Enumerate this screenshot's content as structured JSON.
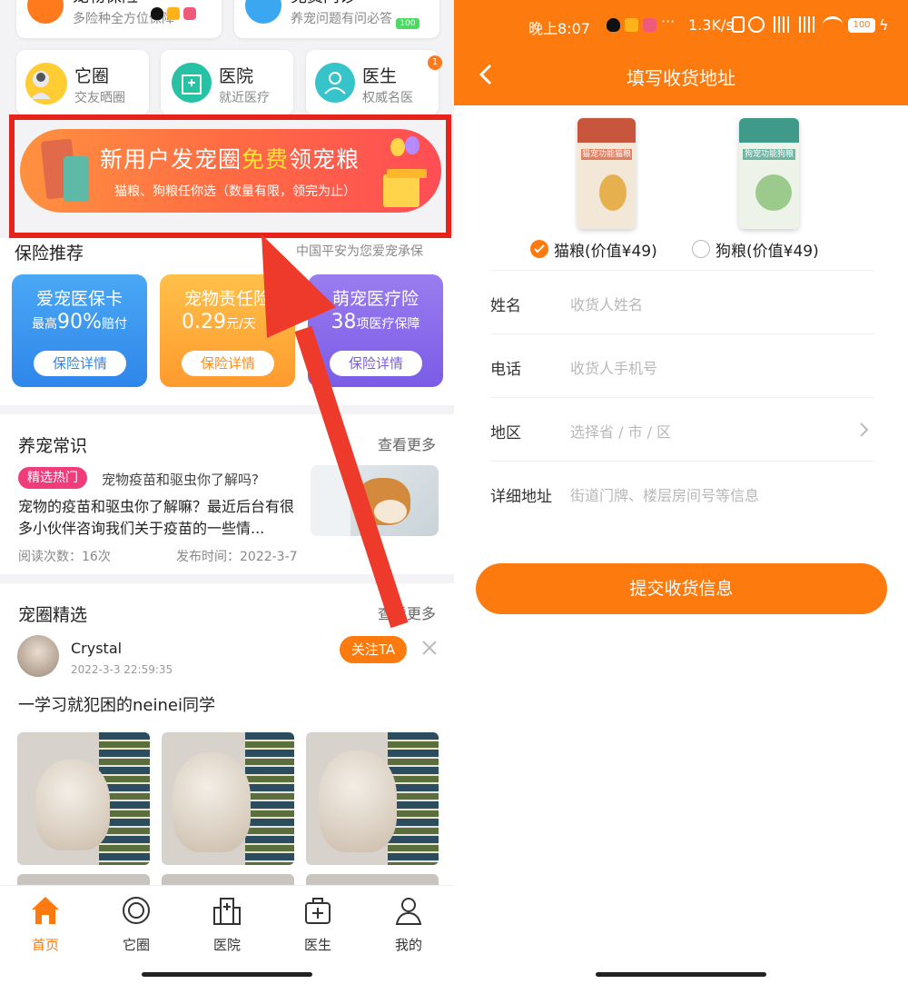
{
  "left": {
    "top_cards": [
      {
        "title": "宠物保险",
        "subtitle": "多险种全方位保障"
      },
      {
        "title": "免费问诊",
        "subtitle": "养宠问题有问必答"
      }
    ],
    "status_overlay": {
      "battery": "100"
    },
    "quick_tiles": [
      {
        "title": "它圈",
        "subtitle": "交友晒圈",
        "icon": "pet-circle-icon"
      },
      {
        "title": "医院",
        "subtitle": "就近医疗",
        "icon": "hospital-icon"
      },
      {
        "title": "医生",
        "subtitle": "权威名医",
        "icon": "doctor-icon",
        "badge": "1"
      }
    ],
    "banner": {
      "title_part1": "新用户发宠圈",
      "title_highlight": "免费",
      "title_part2": "领宠粮",
      "subtitle": "猫粮、狗粮任你选（数量有限，领完为止）"
    },
    "insurance": {
      "heading": "保险推荐",
      "heading_right": "中国平安为您爱宠承保",
      "cards": [
        {
          "title": "爱宠医保卡",
          "sub_prefix": "最高",
          "sub_value": "90%",
          "sub_suffix": "赔付",
          "button": "保险详情",
          "color_from": "#4aa8f5",
          "color_to": "#2f86ea"
        },
        {
          "title": "宠物责任险",
          "sub_prefix": "",
          "sub_value": "0.29",
          "sub_suffix": "元/天",
          "button": "保险详情",
          "color_from": "#ffc04a",
          "color_to": "#ff9a2e"
        },
        {
          "title": "萌宠医疗险",
          "sub_prefix": "",
          "sub_value": "38",
          "sub_suffix": "项医疗保障",
          "button": "保险详情",
          "color_from": "#9a7cf0",
          "color_to": "#7b5ce6"
        }
      ]
    },
    "knowledge": {
      "heading": "养宠常识",
      "more": "查看更多",
      "tag": "精选热门",
      "headline": "宠物疫苗和驱虫你了解吗?",
      "body": "宠物的疫苗和驱虫你了解嘛？最近后台有很多小伙伴咨询我们关于疫苗的一些情...",
      "reads": "阅读次数：16次",
      "published": "发布时间：2022-3-7"
    },
    "feed": {
      "heading": "宠圈精选",
      "more": "查看更多",
      "user": "Crystal",
      "time": "2022-3-3 22:59:35",
      "follow": "关注TA",
      "post_text": "一学习就犯困的neinei同学"
    },
    "bottom_nav": [
      {
        "label": "首页",
        "icon": "home-icon",
        "active": true
      },
      {
        "label": "它圈",
        "icon": "pet-circle-icon",
        "active": false
      },
      {
        "label": "医院",
        "icon": "hospital-icon",
        "active": false
      },
      {
        "label": "医生",
        "icon": "medical-kit-icon",
        "active": false
      },
      {
        "label": "我的",
        "icon": "profile-icon",
        "active": false
      }
    ]
  },
  "right": {
    "status_bar": {
      "time": "晚上8:07",
      "speed": "1.3K/s",
      "battery": "100"
    },
    "title": "填写收货地址",
    "products": [
      {
        "label": "猫粮(价值¥49)",
        "selected": true,
        "bag_text": "猫宠功能猫粮"
      },
      {
        "label": "狗粮(价值¥49)",
        "selected": false,
        "bag_text": "狗宠功能狗粮"
      }
    ],
    "form": [
      {
        "label": "姓名",
        "placeholder": "收货人姓名"
      },
      {
        "label": "电话",
        "placeholder": "收货人手机号"
      },
      {
        "label": "地区",
        "placeholder": "选择省 / 市 / 区"
      },
      {
        "label": "详细地址",
        "placeholder": "街道门牌、楼层房间号等信息"
      }
    ],
    "submit": "提交收货信息"
  },
  "colors": {
    "orange": "#fd7a0f",
    "red_box": "#e8231b",
    "arrow": "#ee3a2a",
    "banner_from": "#ff8a3d",
    "banner_to": "#ff4f4f"
  }
}
